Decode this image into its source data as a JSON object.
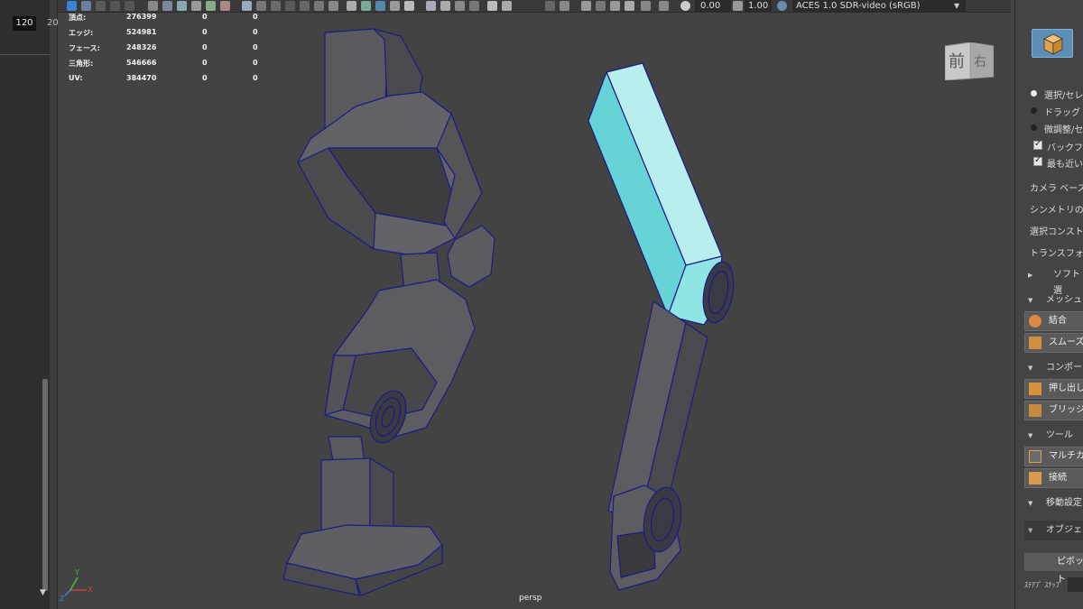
{
  "timeline": {
    "current_frame": "120",
    "next_frame": "20"
  },
  "toolbar": {
    "exposure_value": "0.00",
    "gamma_value": "1.00",
    "color_space": "ACES 1.0 SDR-video (sRGB)"
  },
  "hud": {
    "rows": [
      {
        "label": "頂点:",
        "v1": "276399",
        "v2": "0",
        "v3": "0"
      },
      {
        "label": "エッジ:",
        "v1": "524981",
        "v2": "0",
        "v3": "0"
      },
      {
        "label": "フェース:",
        "v1": "248326",
        "v2": "0",
        "v3": "0"
      },
      {
        "label": "三角形:",
        "v1": "546666",
        "v2": "0",
        "v3": "0"
      },
      {
        "label": "UV:",
        "v1": "384470",
        "v2": "0",
        "v3": "0"
      }
    ]
  },
  "viewport": {
    "camera_name": "persp",
    "axis_x": "X",
    "axis_y": "Y",
    "axis_z": "Z"
  },
  "viewcube": {
    "front_label": "前",
    "right_label": "右"
  },
  "right_panel": {
    "radio_items": [
      "選択/セレ",
      "ドラッグ",
      "微調整/セ"
    ],
    "check_items": [
      "バックフェー",
      "最も近い"
    ],
    "text_items": [
      "カメラ ベースの",
      "シンメトリの軸",
      "選択コンストレ",
      "トランスフォーム"
    ],
    "soft_select": "ソフト選",
    "section_mesh": "メッシュ",
    "btn_combine": "結合",
    "btn_smooth": "スムーズ",
    "section_component": "コンポーネ",
    "btn_extrude": "押し出し",
    "btn_bridge": "ブリッジ",
    "section_tools": "ツール",
    "btn_multicut": "マルチカッ",
    "btn_connect": "接続",
    "section_move": "移動設定",
    "dropdown_object": "オブジェクト",
    "btn_pivot": "ピボット",
    "step_snap": "ｽﾃｱﾌﾟ ｽﾅｯﾌﾟ"
  },
  "colors": {
    "viewport_bg": "#434343",
    "wireframe": "#1a1a8a",
    "selected_object": "#66d4d6",
    "accent_button": "#5d8fb5"
  }
}
